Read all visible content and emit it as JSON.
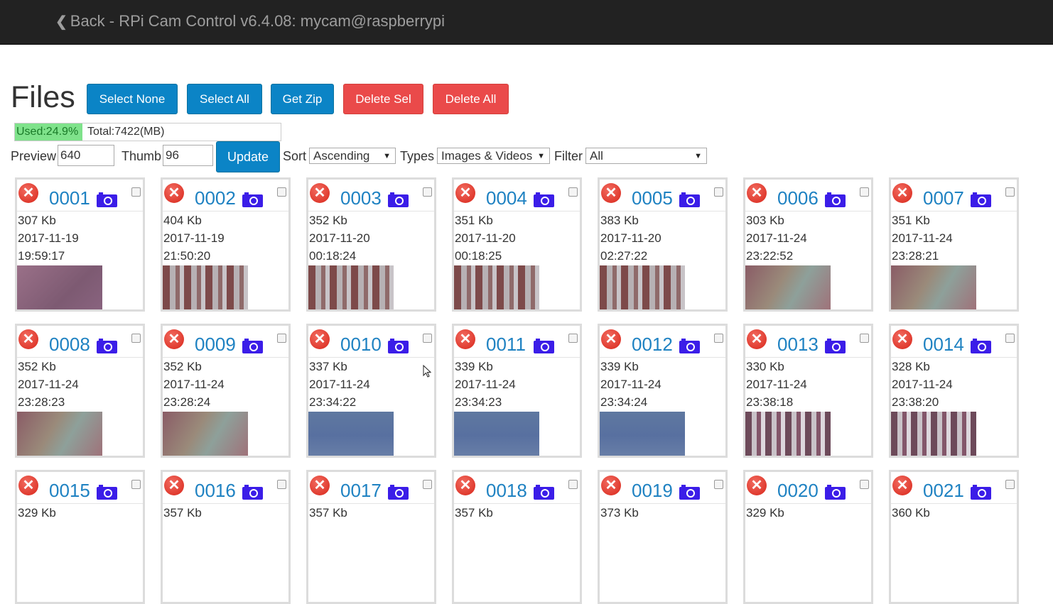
{
  "nav": {
    "back_label": "Back - RPi Cam Control v6.4.08: mycam@raspberrypi"
  },
  "page": {
    "title": "Files"
  },
  "buttons": {
    "select_none": "Select None",
    "select_all": "Select All",
    "get_zip": "Get Zip",
    "delete_sel": "Delete Sel",
    "delete_all": "Delete All"
  },
  "usage": {
    "used_label": "Used:24.9%",
    "used_fraction": 0.249,
    "total_label": "Total:7422(MB)"
  },
  "controls": {
    "preview_label": "Preview",
    "preview_value": "640",
    "thumb_label": "Thumb",
    "thumb_value": "96",
    "update_label": "Update",
    "sort_label": "Sort",
    "sort_value": "Ascending",
    "types_label": "Types",
    "types_value": "Images & Videos",
    "filter_label": "Filter",
    "filter_value": "All"
  },
  "colors": {
    "navbar": "#222222",
    "primary": "#0b84c6",
    "danger": "#ea4a4a",
    "link": "#1f82c2",
    "camera_icon": "#3b1de8",
    "used_bar": "#7fe28b"
  },
  "files": [
    {
      "id": "0001",
      "size": "307 Kb",
      "date": "2017-11-19",
      "time": "19:59:17",
      "thumb": "pink"
    },
    {
      "id": "0002",
      "size": "404 Kb",
      "date": "2017-11-19",
      "time": "21:50:20",
      "thumb": "stripes"
    },
    {
      "id": "0003",
      "size": "352 Kb",
      "date": "2017-11-20",
      "time": "00:18:24",
      "thumb": "stripes"
    },
    {
      "id": "0004",
      "size": "351 Kb",
      "date": "2017-11-20",
      "time": "00:18:25",
      "thumb": "stripes"
    },
    {
      "id": "0005",
      "size": "383 Kb",
      "date": "2017-11-20",
      "time": "02:27:22",
      "thumb": "stripes"
    },
    {
      "id": "0006",
      "size": "303 Kb",
      "date": "2017-11-24",
      "time": "23:22:52",
      "thumb": "haze"
    },
    {
      "id": "0007",
      "size": "351 Kb",
      "date": "2017-11-24",
      "time": "23:28:21",
      "thumb": "haze"
    },
    {
      "id": "0008",
      "size": "352 Kb",
      "date": "2017-11-24",
      "time": "23:28:23",
      "thumb": "haze"
    },
    {
      "id": "0009",
      "size": "352 Kb",
      "date": "2017-11-24",
      "time": "23:28:24",
      "thumb": "haze"
    },
    {
      "id": "0010",
      "size": "337 Kb",
      "date": "2017-11-24",
      "time": "23:34:22",
      "thumb": "blue"
    },
    {
      "id": "0011",
      "size": "339 Kb",
      "date": "2017-11-24",
      "time": "23:34:23",
      "thumb": "blue"
    },
    {
      "id": "0012",
      "size": "339 Kb",
      "date": "2017-11-24",
      "time": "23:34:24",
      "thumb": "blue"
    },
    {
      "id": "0013",
      "size": "330 Kb",
      "date": "2017-11-24",
      "time": "23:38:18",
      "thumb": "stripes2"
    },
    {
      "id": "0014",
      "size": "328 Kb",
      "date": "2017-11-24",
      "time": "23:38:20",
      "thumb": "stripes2"
    },
    {
      "id": "0015",
      "size": "329 Kb"
    },
    {
      "id": "0016",
      "size": "357 Kb"
    },
    {
      "id": "0017",
      "size": "357 Kb"
    },
    {
      "id": "0018",
      "size": "357 Kb"
    },
    {
      "id": "0019",
      "size": "373 Kb"
    },
    {
      "id": "0020",
      "size": "329 Kb"
    },
    {
      "id": "0021",
      "size": "360 Kb"
    }
  ]
}
